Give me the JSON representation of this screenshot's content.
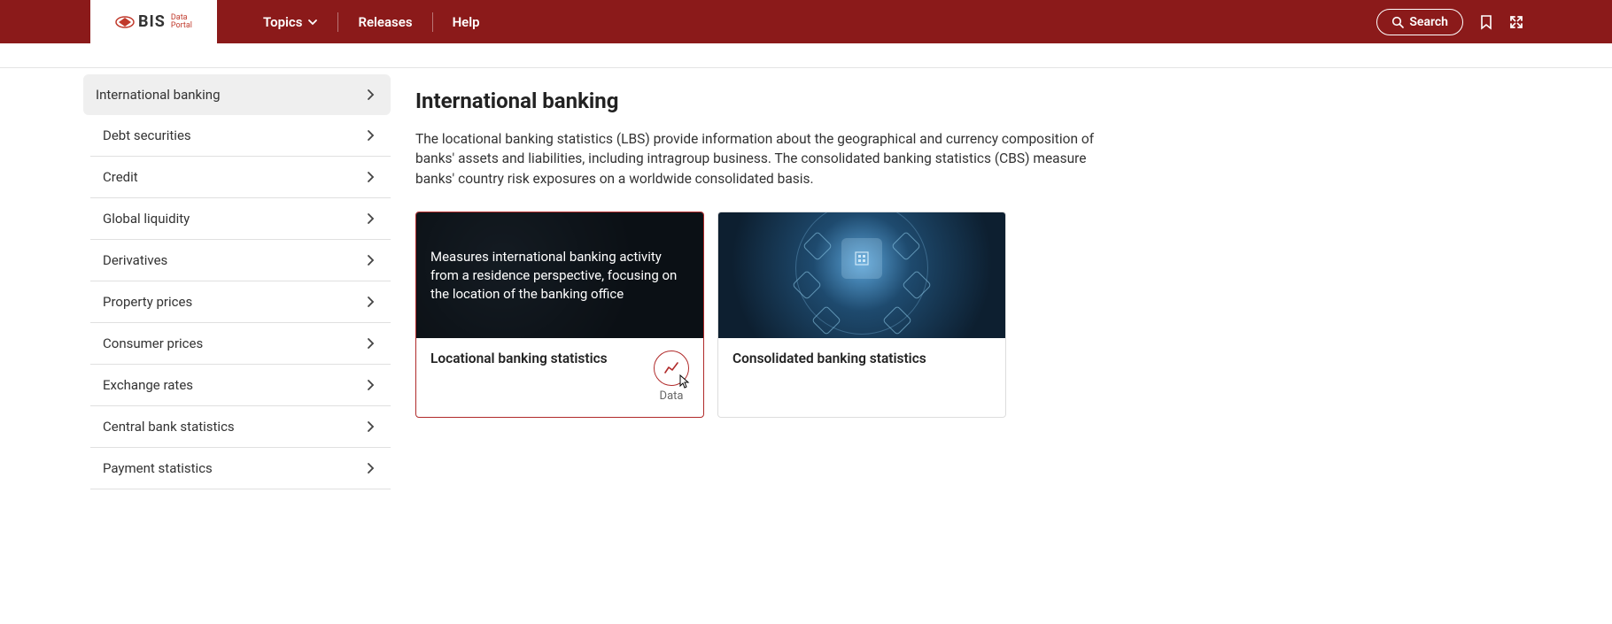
{
  "brand": {
    "name": "BIS",
    "sub1": "Data",
    "sub2": "Portal"
  },
  "nav": {
    "topics": "Topics",
    "releases": "Releases",
    "help": "Help"
  },
  "search": {
    "label": "Search"
  },
  "sidebar": {
    "items": [
      {
        "label": "International banking"
      },
      {
        "label": "Debt securities"
      },
      {
        "label": "Credit"
      },
      {
        "label": "Global liquidity"
      },
      {
        "label": "Derivatives"
      },
      {
        "label": "Property prices"
      },
      {
        "label": "Consumer prices"
      },
      {
        "label": "Exchange rates"
      },
      {
        "label": "Central bank statistics"
      },
      {
        "label": "Payment statistics"
      }
    ]
  },
  "main": {
    "title": "International banking",
    "description": "The locational banking statistics (LBS) provide information about the geographical and currency composition of banks' assets and liabilities, including intragroup business. The consolidated banking statistics (CBS) measure banks' country risk exposures on a worldwide consolidated basis."
  },
  "cards": [
    {
      "title": "Locational banking statistics",
      "overlay": "Measures international banking activity from a residence perspective, focusing on the location of the banking office",
      "data_label": "Data"
    },
    {
      "title": "Consolidated banking statistics"
    }
  ]
}
